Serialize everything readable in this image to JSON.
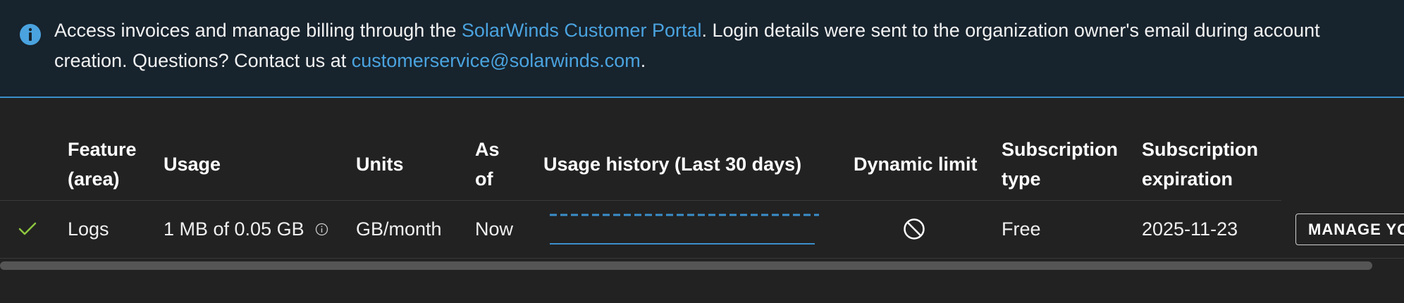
{
  "banner": {
    "text_before": "Access invoices and manage billing through the ",
    "portal_link": "SolarWinds Customer Portal",
    "text_middle": ". Login details were sent to the organization owner's email during account creation. Questions? Contact us at ",
    "email_link": "customerservice@solarwinds.com",
    "text_after": ".",
    "icon": "info-icon"
  },
  "table": {
    "headers": {
      "feature_line1": "Feature",
      "feature_line2": "(area)",
      "usage": "Usage",
      "units": "Units",
      "as_of_line1": "As",
      "as_of_line2": "of",
      "usage_history": "Usage history (Last 30 days)",
      "dynamic_limit": "Dynamic limit",
      "sub_type_line1": "Subscription",
      "sub_type_line2": "type",
      "sub_exp_line1": "Subscription",
      "sub_exp_line2": "expiration"
    },
    "rows": [
      {
        "status_icon": "check-icon",
        "feature": "Logs",
        "usage": "1 MB of 0.05 GB",
        "usage_info_icon": "info-icon",
        "units": "GB/month",
        "as_of": "Now",
        "dynamic_limit_icon": "prohibited-icon",
        "subscription_type": "Free",
        "subscription_expiration": "2025-11-23",
        "action_label": "MANAGE YOUR SUBSCRIPTION"
      }
    ]
  },
  "colors": {
    "accent": "#4aa3df",
    "check": "#8dc63f",
    "banner_bg": "#17232d",
    "page_bg": "#222222"
  }
}
